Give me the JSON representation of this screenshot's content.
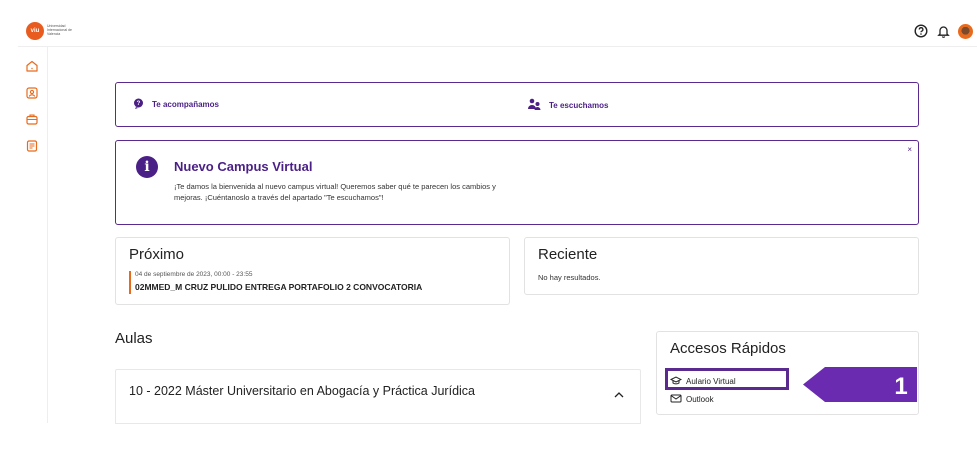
{
  "brand": {
    "logo_text": "viu",
    "logo_caption": "Universidad Internacional de Valencia"
  },
  "topbar": {
    "icons": [
      "help-icon",
      "bell-icon",
      "avatar"
    ]
  },
  "sidebar": {
    "icons": [
      "home-icon",
      "profile-icon",
      "briefcase-icon",
      "document-icon"
    ]
  },
  "banner": {
    "left_label": "Te acompañamos",
    "right_label": "Te escuchamos"
  },
  "notice": {
    "title": "Nuevo Campus Virtual",
    "body_line1": "¡Te damos la bienvenida al nuevo campus virtual! Queremos saber qué te parecen los cambios y",
    "body_line2": "mejoras. ¡Cuéntanoslo a través del apartado \"Te escuchamos\"!",
    "close": "×"
  },
  "proximo": {
    "heading": "Próximo",
    "date": "04 de septiembre de 2023, 00:00 - 23:55",
    "event": "02MMED_M CRUZ PULIDO ENTREGA PORTAFOLIO 2 CONVOCATORIA"
  },
  "reciente": {
    "heading": "Reciente",
    "empty": "No hay resultados."
  },
  "aulas": {
    "heading": "Aulas",
    "course_title": "10 - 2022 Máster Universitario en Abogacía y Práctica Jurídica"
  },
  "accesos": {
    "heading": "Accesos Rápidos",
    "links": [
      "Aulario Virtual",
      "Outlook"
    ]
  },
  "annotation": {
    "step": "1"
  },
  "colors": {
    "brand_purple": "#4a1f86",
    "border_purple": "#5b2a8e",
    "accent_orange": "#e86a1c",
    "arrow_purple": "#6a2bb0"
  }
}
